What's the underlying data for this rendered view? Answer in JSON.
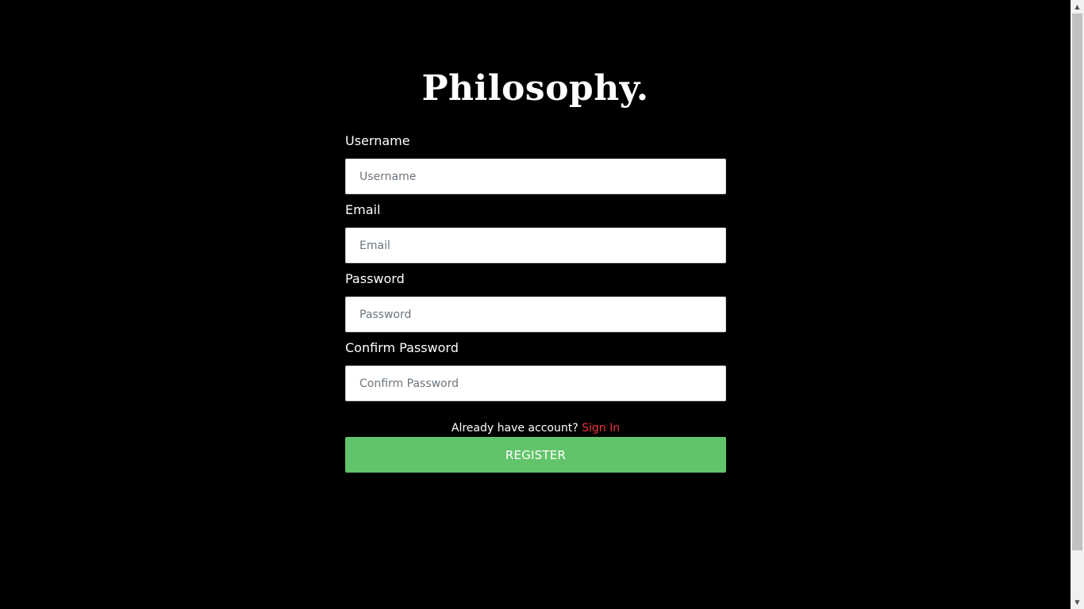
{
  "brand": {
    "title": "Philosophy."
  },
  "form": {
    "fields": [
      {
        "label": "Username",
        "placeholder": "Username",
        "value": ""
      },
      {
        "label": "Email",
        "placeholder": "Email",
        "value": ""
      },
      {
        "label": "Password",
        "placeholder": "Password",
        "value": ""
      },
      {
        "label": "Confirm Password",
        "placeholder": "Confirm Password",
        "value": ""
      }
    ],
    "signin_prompt": "Already have account?",
    "signin_link": "Sign In",
    "register_label": "REGISTER"
  },
  "colors": {
    "background": "#000000",
    "accent_link": "#e8323a",
    "button": "#62c46a"
  },
  "icons": {
    "scroll_up": "scroll-up-arrow-icon",
    "scroll_down": "scroll-down-arrow-icon"
  }
}
